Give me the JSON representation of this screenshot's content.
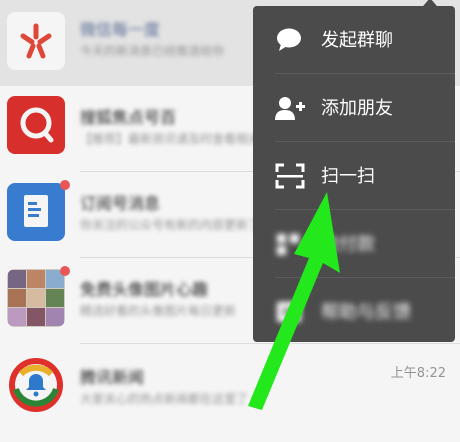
{
  "chats": [
    {
      "name": "微信每一度",
      "preview": "今天的新消息已经推送给你",
      "time": "",
      "badge": false,
      "avatar": "red-flower-logo-icon"
    },
    {
      "name": "搜狐焦点号百",
      "preview": "【推荐】最新资讯请及时查看相关内容",
      "time": "",
      "badge": false,
      "avatar": "red-search-logo-icon"
    },
    {
      "name": "订阅号消息",
      "preview": "你关注的公众号有新的内容更新了",
      "time": "",
      "badge": true,
      "avatar": "blue-document-icon"
    },
    {
      "name": "免费头像图片心趣",
      "preview": "精选好看的头像图片每日更新",
      "time": "",
      "badge": true,
      "avatar": "photo-grid-avatar"
    },
    {
      "name": "腾讯新闻",
      "preview": "大家关心的热点新闻都在这里了",
      "time": "上午8:22",
      "badge": false,
      "avatar": "tencent-news-logo-icon"
    }
  ],
  "menu": {
    "items": [
      {
        "label": "发起群聊",
        "icon": "chat-bubble-icon"
      },
      {
        "label": "添加朋友",
        "icon": "add-friend-icon"
      },
      {
        "label": "扫一扫",
        "icon": "scan-icon"
      },
      {
        "label": "收付款",
        "icon": "payment-icon"
      },
      {
        "label": "帮助与反馈",
        "icon": "help-feedback-icon"
      }
    ]
  },
  "colors": {
    "menu_bg": "#4b4b4b",
    "annotation_arrow": "#22e81c",
    "badge": "#f35a5a"
  }
}
